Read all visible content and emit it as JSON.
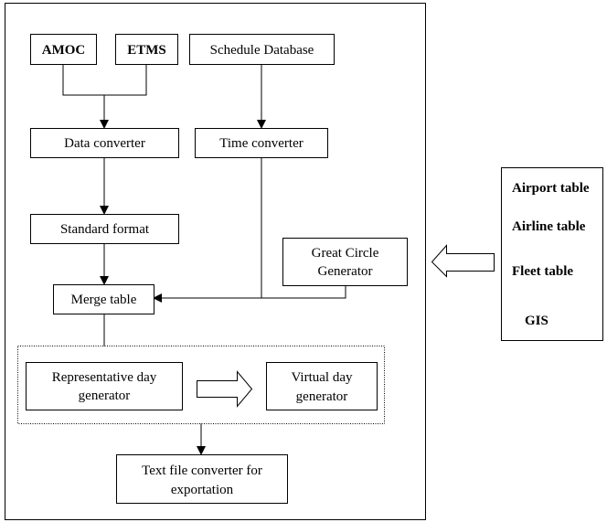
{
  "nodes": {
    "amoc": "AMOC",
    "etms": "ETMS",
    "schedule_db": "Schedule Database",
    "data_converter": "Data converter",
    "time_converter": "Time converter",
    "standard_format": "Standard format",
    "great_circle": [
      "Great Circle",
      "Generator"
    ],
    "merge_table": "Merge table",
    "representative_day": [
      "Representative day",
      "generator"
    ],
    "virtual_day": [
      "Virtual day",
      "generator"
    ],
    "text_file_converter": [
      "Text file converter for",
      "exportation"
    ]
  },
  "tables": [
    "Airport table",
    "Airline table",
    "Fleet table",
    "GIS"
  ]
}
